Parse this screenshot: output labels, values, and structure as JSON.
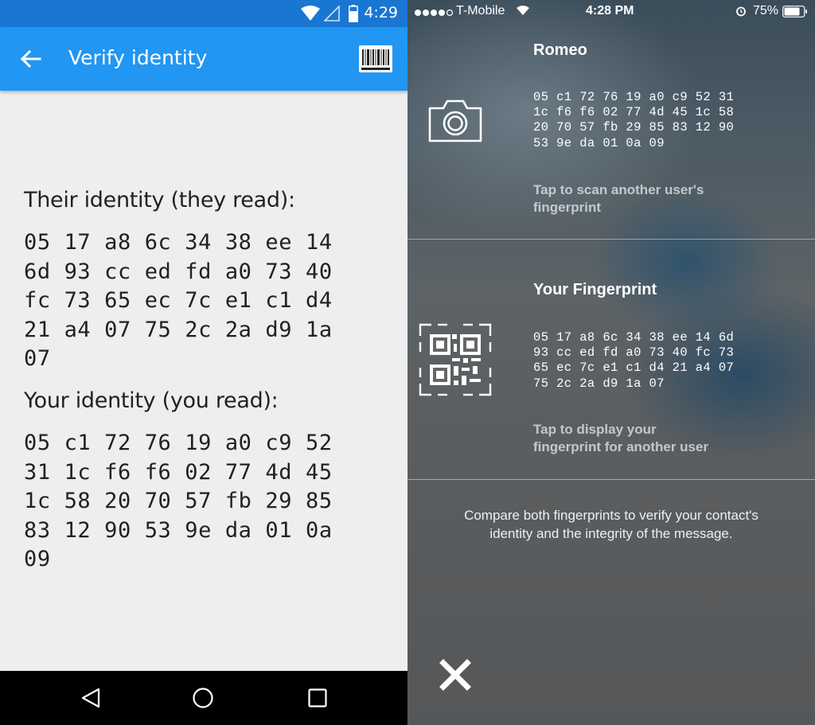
{
  "android": {
    "status_bar": {
      "time": "4:29"
    },
    "toolbar": {
      "title": "Verify identity"
    },
    "their_identity": {
      "heading": "Their identity (they read):",
      "lines": [
        "05 17 a8 6c 34 38 ee 14",
        "6d 93 cc ed fd a0 73 40",
        "fc 73 65 ec 7c e1 c1 d4",
        "21 a4 07 75 2c 2a d9 1a",
        "07"
      ]
    },
    "your_identity": {
      "heading": "Your identity (you read):",
      "lines": [
        "05 c1 72 76 19 a0 c9 52",
        "31 1c f6 f6 02 77 4d 45",
        "1c 58 20 70 57 fb 29 85",
        "83 12 90 53 9e da 01 0a",
        "09"
      ]
    },
    "nav": {
      "icons": [
        "back-triangle-icon",
        "home-circle-icon",
        "recents-square-icon"
      ]
    }
  },
  "ios": {
    "status_bar": {
      "signal_dots": "●●●●○",
      "carrier": "T-Mobile",
      "time": "4:28 PM",
      "battery_pct": "75%"
    },
    "contact": {
      "name": "Romeo",
      "lines": [
        "05 c1 72 76 19 a0 c9 52 31",
        "1c f6 f6 02 77 4d 45 1c 58",
        "20 70 57 fb 29 85 83 12 90",
        "53 9e da 01 0a 09"
      ],
      "hint_line1": "Tap to scan another user's",
      "hint_line2": "fingerprint"
    },
    "own": {
      "name": "Your Fingerprint",
      "lines": [
        "05 17 a8 6c 34 38 ee 14 6d",
        "93 cc ed fd a0 73 40 fc 73",
        "65 ec 7c e1 c1 d4 21 a4 07",
        "75 2c 2a d9 1a 07"
      ],
      "hint_line1": "Tap to display your",
      "hint_line2": "fingerprint for another user"
    },
    "compare_line1": "Compare both fingerprints to verify your contact's",
    "compare_line2": "identity and the integrity of the message."
  }
}
